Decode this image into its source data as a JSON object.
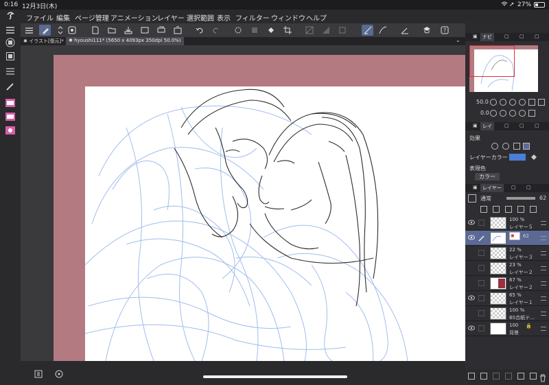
{
  "status": {
    "time": "0:16",
    "date": "12月3日(木)",
    "battery": "27%"
  },
  "menu": {
    "items": [
      "ファイル",
      "編集",
      "ページ管理",
      "アニメーション",
      "レイヤー",
      "選択範囲",
      "表示",
      "フィルター",
      "ウィンドウ",
      "ヘルプ"
    ]
  },
  "tabs": {
    "tab1": "イラスト[復元]*",
    "tab2": "hyoushi111* (5650 x 4093px 350dpi 50.0%)"
  },
  "navigator": {
    "tab_navi": "ナビ",
    "zoom": "50.0",
    "rotation": "0.0"
  },
  "properties": {
    "tab_label": "レイ",
    "effect_label": "効果",
    "layer_color_label": "レイヤーカラー",
    "layer_color": "#4a7fd8",
    "expression_label": "表現色",
    "color_value": "カラー"
  },
  "layers_panel": {
    "tab_label": "レイヤー",
    "blend_mode": "通常",
    "opacity": "62",
    "layers": [
      {
        "opacity": "100 %",
        "name": "レイヤー５",
        "visible": true,
        "selected": false,
        "thumb": "checker"
      },
      {
        "opacity": "62",
        "name": "",
        "visible": true,
        "selected": true,
        "thumb": "sketch"
      },
      {
        "opacity": "22 %",
        "name": "レイヤー３",
        "visible": false,
        "selected": false,
        "thumb": "checker"
      },
      {
        "opacity": "23 %",
        "name": "レイヤー２",
        "visible": false,
        "selected": false,
        "thumb": "checker"
      },
      {
        "opacity": "67 %",
        "name": "レイヤー２",
        "visible": false,
        "selected": false,
        "thumb": "red"
      },
      {
        "opacity": "65 %",
        "name": "レイヤー１",
        "visible": true,
        "selected": false,
        "thumb": "checker"
      },
      {
        "opacity": "100 %",
        "name": "BS合紙テ…",
        "visible": false,
        "selected": false,
        "thumb": "checker"
      },
      {
        "opacity": "100",
        "name": "背景",
        "visible": true,
        "selected": false,
        "thumb": "white"
      }
    ]
  },
  "colors": {
    "accent": "#5b6a95",
    "frame": "#b47a82",
    "sketch_blue": "#7aa4e0"
  }
}
